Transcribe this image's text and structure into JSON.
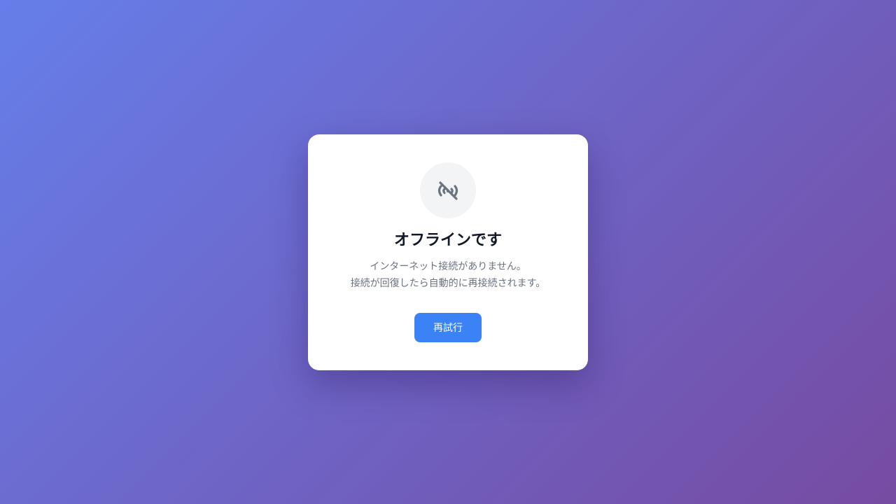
{
  "dialog": {
    "icon": "wifi-off-icon",
    "title": "オフラインです",
    "message_line1": "インターネット接続がありません。",
    "message_line2": "接続が回復したら自動的に再接続されます。",
    "retry_label": "再試行"
  },
  "colors": {
    "background_start": "#667eea",
    "background_end": "#764ba2",
    "card": "#ffffff",
    "icon_bg": "#f3f4f6",
    "icon": "#6b7280",
    "title": "#111827",
    "text": "#6b7280",
    "button": "#3b82f6",
    "button_text": "#ffffff"
  }
}
